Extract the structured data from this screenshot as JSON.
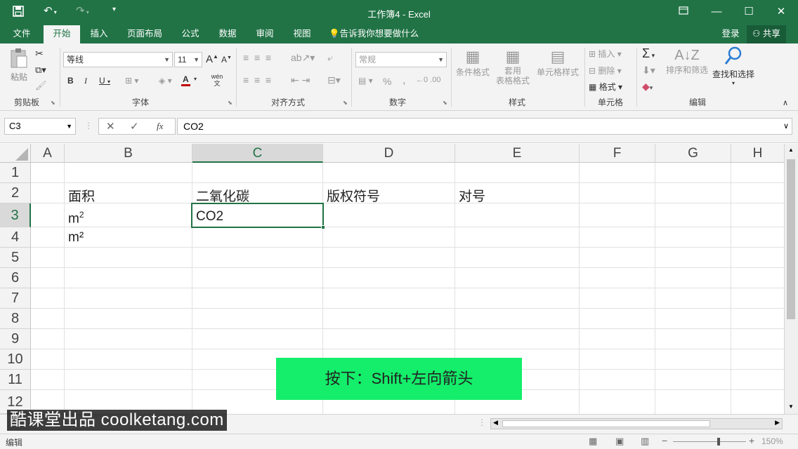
{
  "window": {
    "title": "工作簿4 - Excel"
  },
  "menu": {
    "tabs": [
      "文件",
      "开始",
      "插入",
      "页面布局",
      "公式",
      "数据",
      "审阅",
      "视图"
    ],
    "tellme": "告诉我你想要做什么",
    "login": "登录",
    "share": "共享"
  },
  "ribbon": {
    "clipboard": {
      "paste": "粘贴",
      "label": "剪贴板"
    },
    "font": {
      "name": "等线",
      "size": "11",
      "label": "字体",
      "bold": "B",
      "italic": "I",
      "underline": "U",
      "grow": "A",
      "shrink": "A",
      "color_a": "A",
      "wen": "wén 文"
    },
    "align": {
      "label": "对齐方式"
    },
    "number": {
      "format": "常规",
      "percent": "%",
      "comma": ",",
      "label": "数字"
    },
    "styles": {
      "cond": "条件格式",
      "table1": "套用",
      "table2": "表格格式",
      "cell": "单元格样式",
      "label": "样式"
    },
    "cells": {
      "insert": "插入",
      "delete": "删除",
      "format": "格式",
      "label": "单元格"
    },
    "editing": {
      "sort": "排序和筛选",
      "find": "查找和选择",
      "label": "编辑",
      "sigma": "Σ"
    }
  },
  "formula": {
    "namebox": "C3",
    "value": "CO2",
    "fx": "fx"
  },
  "columns": [
    "A",
    "B",
    "C",
    "D",
    "E",
    "F",
    "G",
    "H"
  ],
  "rows": [
    "1",
    "2",
    "3",
    "4",
    "5",
    "6",
    "7",
    "8",
    "9",
    "10",
    "11",
    "12"
  ],
  "cells": {
    "B2": "面积",
    "C2": "二氧化碳",
    "D2": "版权符号",
    "E2": "对号",
    "B3": "m",
    "B3sup": "2",
    "C3": "CO2",
    "B4": "m²"
  },
  "banner": "按下：Shift+左向箭头",
  "watermark": "酷课堂出品 coolketang.com",
  "status": {
    "mode": "编辑",
    "zoom": "150%"
  },
  "colors": {
    "accent": "#217346",
    "banner": "#14ee6a"
  }
}
